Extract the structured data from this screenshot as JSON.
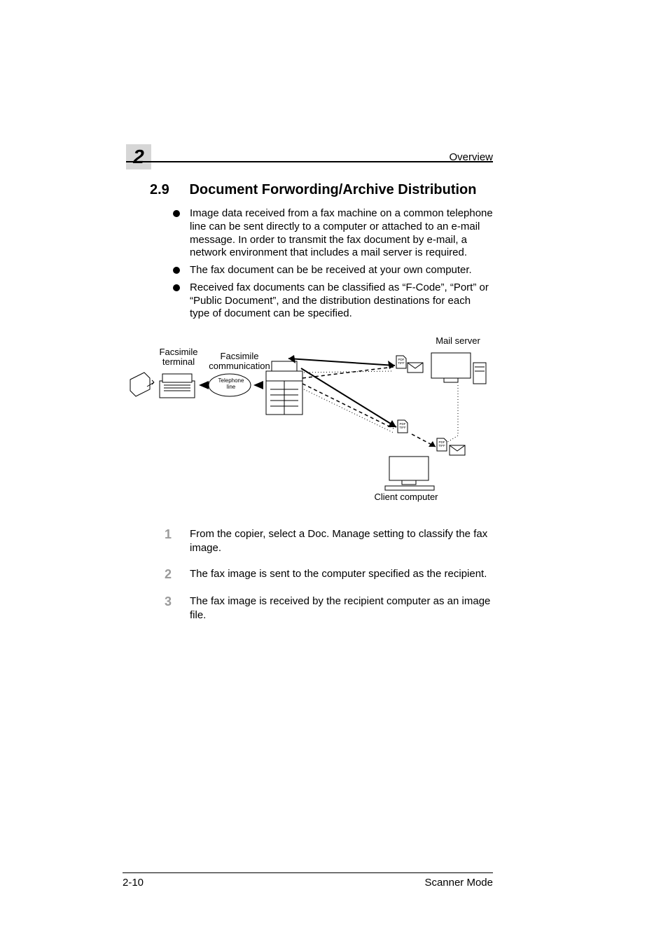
{
  "chapter_number": "2",
  "header_label": "Overview",
  "section": {
    "number": "2.9",
    "title": "Document Forwording/Archive Distribution"
  },
  "bullets": [
    " Image data received from a fax machine on a common telephone line can be sent directly to a computer or attached to an e-mail message. In order to transmit the fax document by e-mail, a network environment that includes a mail server is required.",
    "The fax document can be be received at your own computer.",
    "Received fax documents can be classified as “F-Code”, “Port” or “Public Document”, and the distribution destinations for each type of document can be specified."
  ],
  "diagram": {
    "facsimile_terminal": "Facsimile\nterminal",
    "facsimile_communication": "Facsimile\ncommunication",
    "telephone_line": "Telephone\nline",
    "mail_server": "Mail server",
    "client_computer": "Client computer",
    "file_badge": "PDF\nTIFF"
  },
  "steps": [
    {
      "n": "1",
      "t": "From the copier, select a Doc. Manage setting to classify the fax image."
    },
    {
      "n": "2",
      "t": "The fax image is sent to the computer specified as the recipient."
    },
    {
      "n": "3",
      "t": "The fax image is received by the recipient computer as an image file."
    }
  ],
  "footer": {
    "page": "2-10",
    "mode": "Scanner Mode"
  }
}
